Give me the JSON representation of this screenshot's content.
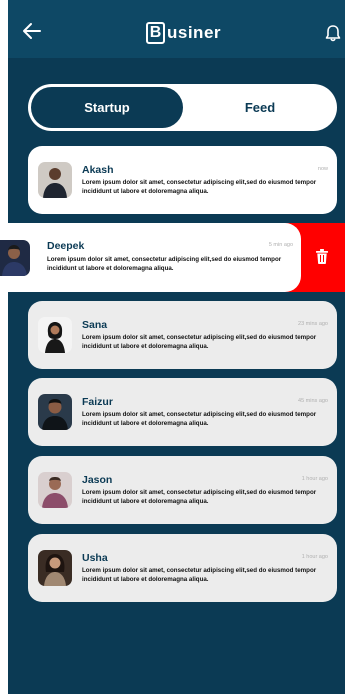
{
  "header": {
    "logo_letter": "B",
    "logo_text": "usiner",
    "back_icon": "arrow-left-icon",
    "bell_icon": "bell-icon"
  },
  "tabs": [
    {
      "label": "Startup",
      "active": true
    },
    {
      "label": "Feed",
      "active": false
    }
  ],
  "messages": [
    {
      "name": "Akash",
      "time": "now",
      "text": "Lorem ipsum dolor sit amet, consectetur adipiscing elit,sed do eiusmod tempor incididunt ut labore et doloremagna aliqua."
    },
    {
      "name": "Deepek",
      "time": "5 min ago",
      "text": "Lorem ipsum dolor sit amet, consectetur adipiscing elit,sed do eiusmod tempor incididunt ut labore et doloremagna aliqua."
    },
    {
      "name": "Sana",
      "time": "23 mins ago",
      "text": "Lorem ipsum dolor sit amet, consectetur adipiscing elit,sed do eiusmod tempor incididunt ut labore et doloremagna aliqua."
    },
    {
      "name": "Faizur",
      "time": "45 mins ago",
      "text": "Lorem ipsum dolor sit amet, consectetur adipiscing elit,sed do eiusmod tempor incididunt ut labore et doloremagna aliqua."
    },
    {
      "name": "Jason",
      "time": "1 hour ago",
      "text": "Lorem ipsum dolor sit amet, consectetur adipiscing elit,sed do eiusmod tempor incididunt ut labore et doloremagna aliqua."
    },
    {
      "name": "Usha",
      "time": "1 hour ago",
      "text": "Lorem ipsum dolor sit amet, consectetur adipiscing elit,sed do eiusmod tempor incididunt ut labore et doloremagna aliqua."
    }
  ],
  "delete_icon": "trash-icon",
  "colors": {
    "primary": "#0b3a54",
    "topbar": "#0e4865",
    "delete": "#ff0000",
    "card": "#ececec"
  }
}
